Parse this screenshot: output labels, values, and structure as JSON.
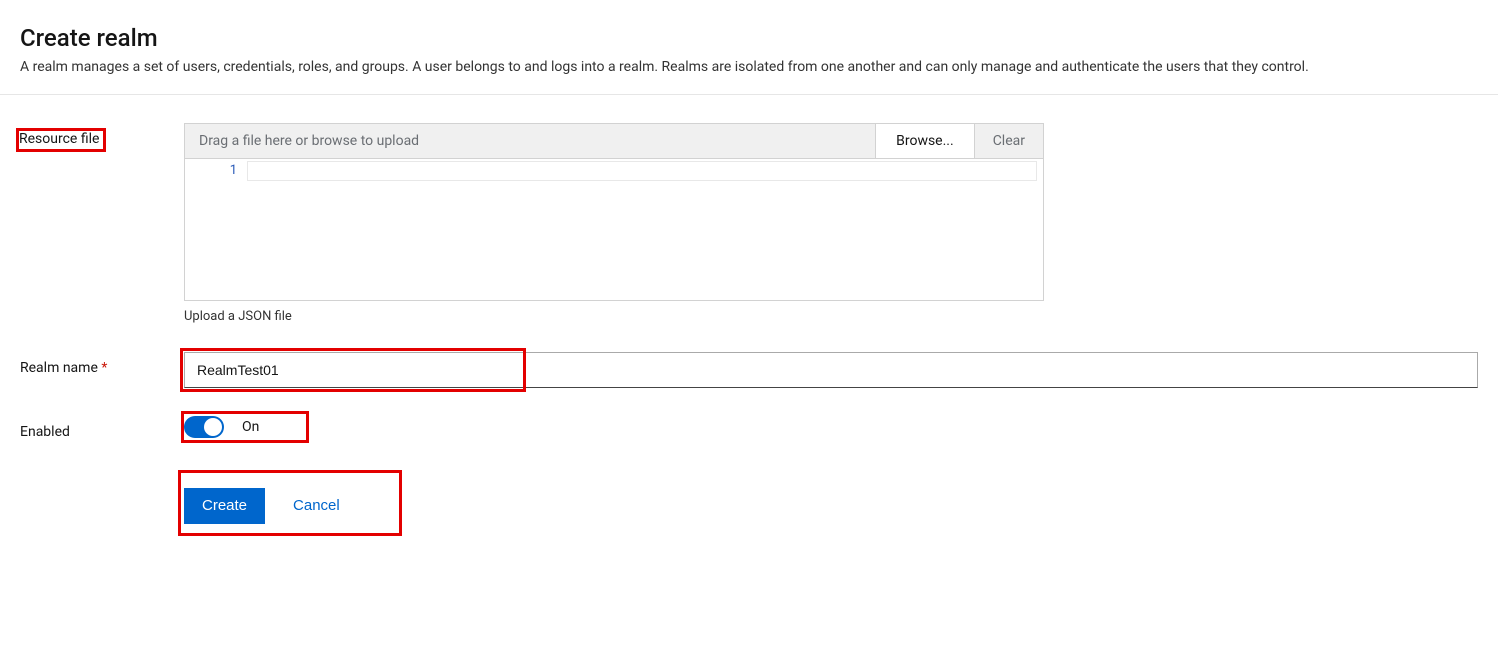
{
  "header": {
    "title": "Create realm",
    "subtitle": "A realm manages a set of users, credentials, roles, and groups. A user belongs to and logs into a realm. Realms are isolated from one another and can only manage and authenticate the users that they control."
  },
  "form": {
    "resource_file": {
      "label": "Resource file",
      "dropzone_text": "Drag a file here or browse to upload",
      "browse_label": "Browse...",
      "clear_label": "Clear",
      "editor": {
        "line_number": "1",
        "content": ""
      },
      "helper": "Upload a JSON file"
    },
    "realm_name": {
      "label": "Realm name",
      "value": "RealmTest01"
    },
    "enabled": {
      "label": "Enabled",
      "state": "On"
    },
    "actions": {
      "create": "Create",
      "cancel": "Cancel"
    }
  },
  "colors": {
    "accent": "#0066cc",
    "highlight_border": "#e30000"
  }
}
